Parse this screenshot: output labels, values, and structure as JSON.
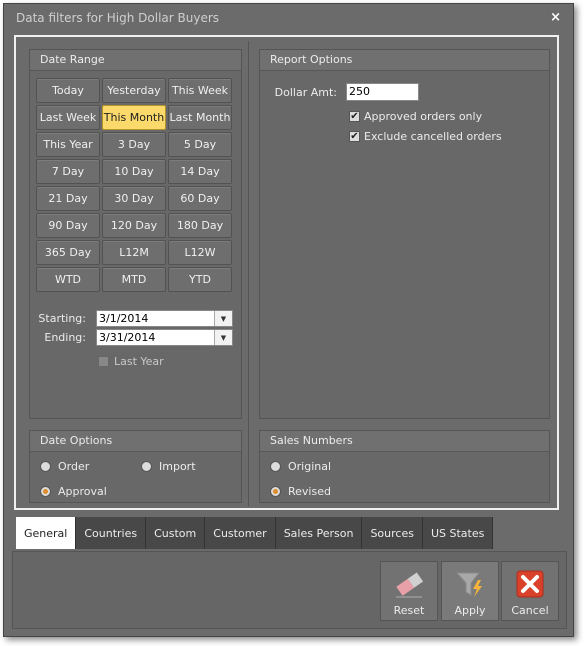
{
  "window": {
    "title": "Data filters for High Dollar Buyers",
    "close_glyph": "×"
  },
  "date_range": {
    "title": "Date Range",
    "buttons": [
      "Today",
      "Yesterday",
      "This Week",
      "Last Week",
      "This Month",
      "Last Month",
      "This Year",
      "3 Day",
      "5 Day",
      "7 Day",
      "10 Day",
      "14 Day",
      "21 Day",
      "30 Day",
      "60 Day",
      "90 Day",
      "120 Day",
      "180 Day",
      "365 Day",
      "L12M",
      "L12W",
      "WTD",
      "MTD",
      "YTD"
    ],
    "active_button": "This Month",
    "starting_label": "Starting:",
    "starting_value": "3/1/2014",
    "ending_label": "Ending:",
    "ending_value": "3/31/2014",
    "last_year_label": "Last Year",
    "last_year_checked": false
  },
  "report_options": {
    "title": "Report Options",
    "dollar_label": "Dollar Amt:",
    "dollar_value": "250",
    "approved_label": "Approved orders only",
    "approved_checked": true,
    "exclude_label": "Exclude cancelled orders",
    "exclude_checked": true
  },
  "date_options": {
    "title": "Date Options",
    "order_label": "Order",
    "import_label": "Import",
    "approval_label": "Approval",
    "selected": "Approval"
  },
  "sales_numbers": {
    "title": "Sales Numbers",
    "original_label": "Original",
    "revised_label": "Revised",
    "selected": "Revised"
  },
  "tabs": [
    "General",
    "Countries",
    "Custom",
    "Customer",
    "Sales Person",
    "Sources",
    "US States"
  ],
  "active_tab": "General",
  "actions": {
    "reset": "Reset",
    "apply": "Apply",
    "cancel": "Cancel"
  },
  "colors": {
    "accent": "#fcd96b",
    "radio_dot": "#e08c2a",
    "cancel_red": "#d9412a",
    "window_bg": "#6b6b6b"
  },
  "icons": {
    "reset": "eraser-icon",
    "apply": "funnel-lightning-icon",
    "cancel": "x-box-icon",
    "close": "close-icon"
  }
}
